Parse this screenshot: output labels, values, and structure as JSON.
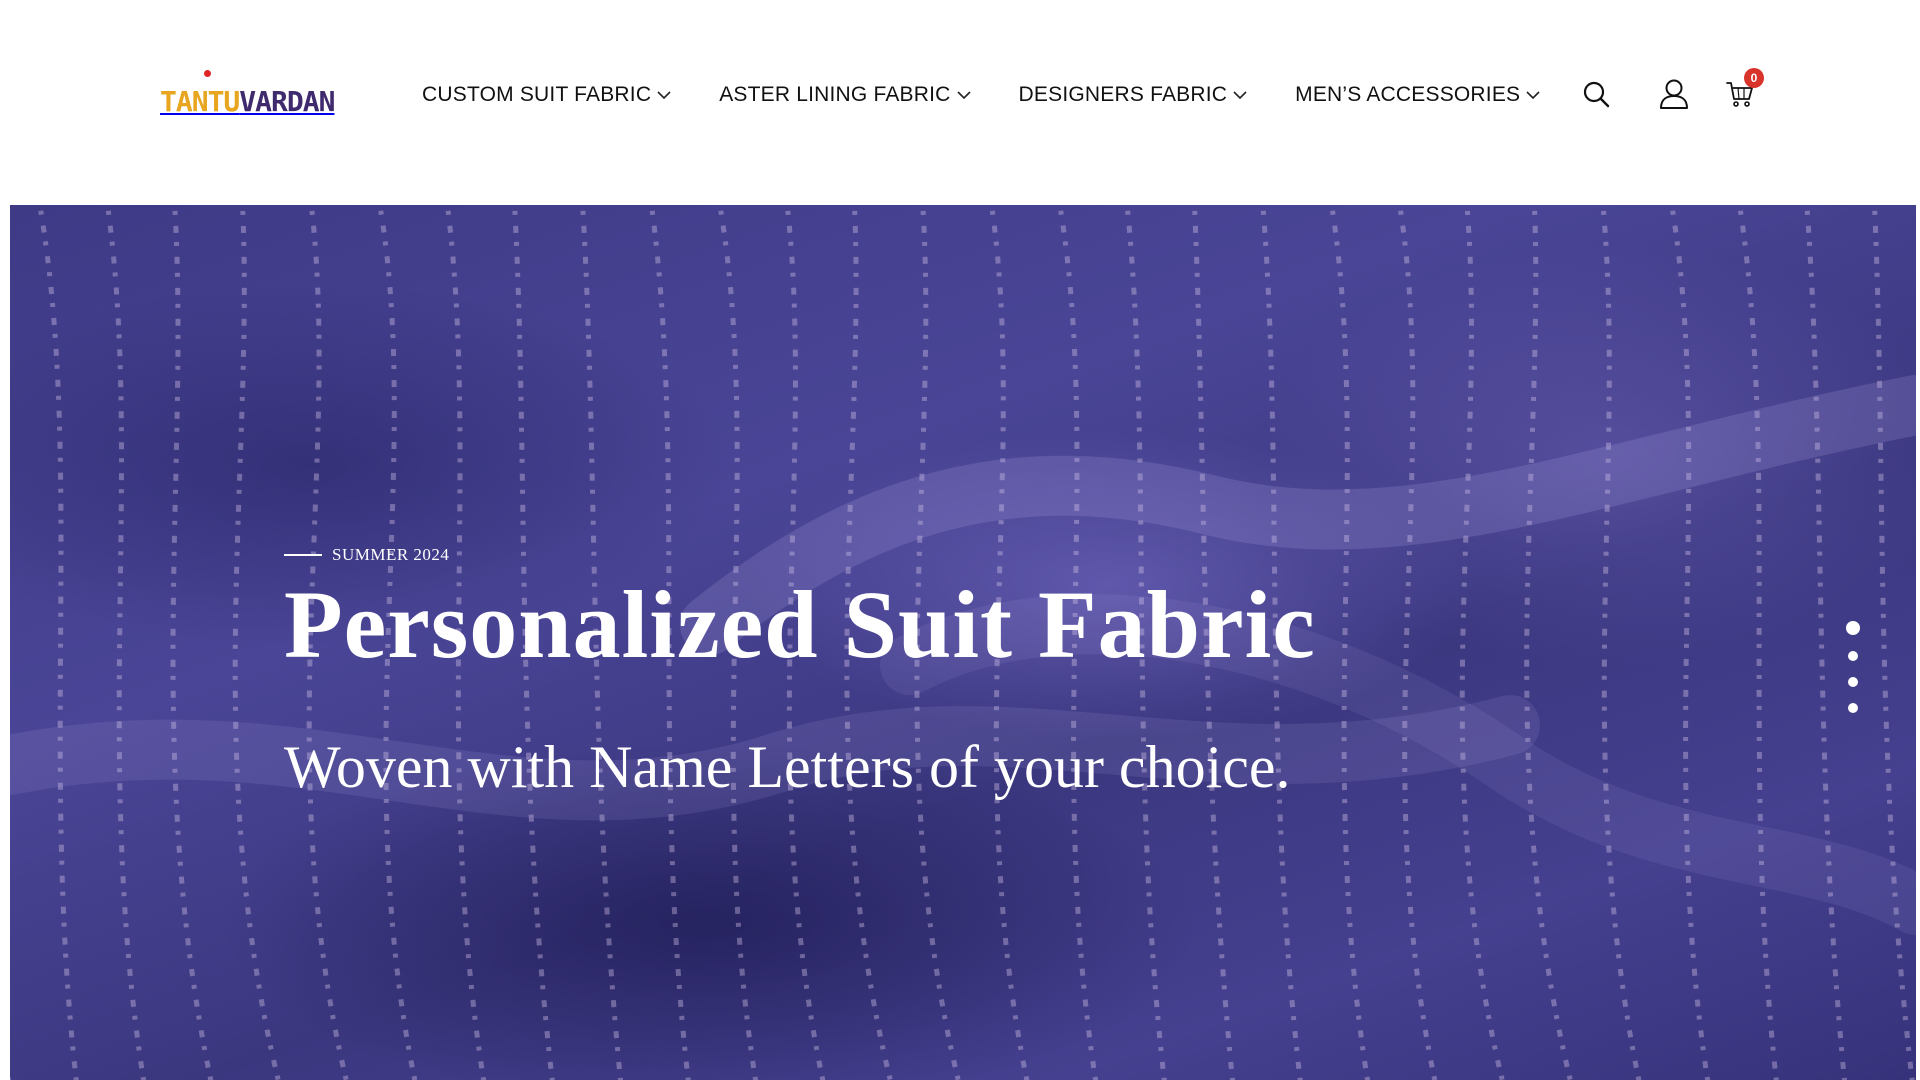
{
  "brand": {
    "logo_text_part1": "TANTU",
    "logo_text_part2": "VARDAN",
    "colors": {
      "primary": "#e8a51f",
      "secondary": "#3f2a6e",
      "accent_dot": "#e02424"
    }
  },
  "nav": {
    "items": [
      {
        "label": "CUSTOM SUIT FABRIC",
        "icon": "chevron-down-icon"
      },
      {
        "label": "ASTER LINING FABRIC",
        "icon": "chevron-down-icon"
      },
      {
        "label": "DESIGNERS FABRIC",
        "icon": "chevron-down-icon"
      },
      {
        "label": "MEN’S ACCESSORIES",
        "icon": "chevron-down-icon"
      }
    ]
  },
  "header_icons": {
    "search": "search-icon",
    "account": "user-icon",
    "cart": "cart-icon",
    "cart_count": "0",
    "badge_color": "#d9342b"
  },
  "hero": {
    "eyebrow": "SUMMER 2024",
    "title": "Personalized Suit Fabric",
    "subtitle": "Woven with Name Letters of your choice.",
    "background_color": "#433f8c",
    "slide_count": 4,
    "active_slide": 1
  }
}
